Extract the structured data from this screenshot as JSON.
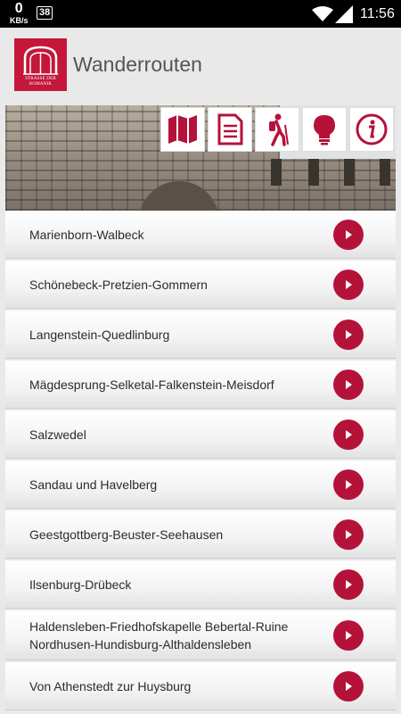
{
  "status_bar": {
    "speed_value": "0",
    "speed_unit": "KB/s",
    "notification_count": "38",
    "time": "11:56"
  },
  "header": {
    "title": "Wanderrouten",
    "logo_text": "STRASSE DER ROMANIK"
  },
  "toolbar": {
    "icons": [
      "map-icon",
      "document-icon",
      "hiker-icon",
      "lightbulb-icon",
      "info-icon"
    ]
  },
  "colors": {
    "accent": "#b5123a",
    "logo_bg": "#c4173a"
  },
  "routes": [
    {
      "label": "Marienborn-Walbeck"
    },
    {
      "label": "Schönebeck-Pretzien-Gommern"
    },
    {
      "label": "Langenstein-Quedlinburg"
    },
    {
      "label": "Mägdesprung-Selketal-Falkenstein-Meisdorf"
    },
    {
      "label": "Salzwedel"
    },
    {
      "label": "Sandau und Havelberg"
    },
    {
      "label": "Geestgottberg-Beuster-Seehausen"
    },
    {
      "label": "Ilsenburg-Drübeck"
    },
    {
      "label": "Haldensleben-Friedhofskapelle Bebertal-Ruine\nNordhusen-Hundisburg-Althaldensleben"
    },
    {
      "label": "Von Athenstedt zur Huysburg"
    }
  ]
}
